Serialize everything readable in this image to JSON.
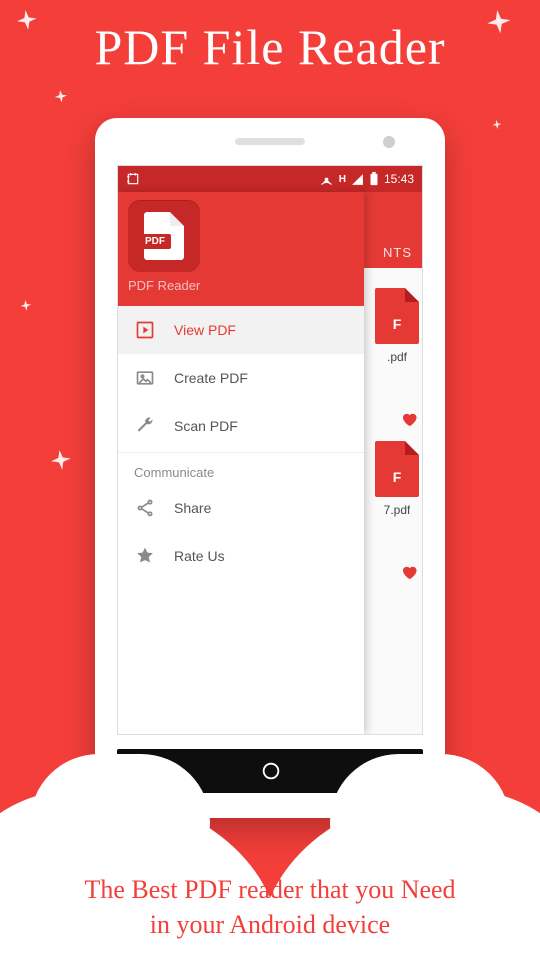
{
  "poster": {
    "title": "PDF File Reader",
    "subtitle_line1": "The Best PDF reader that you Need",
    "subtitle_line2": "in your Android device"
  },
  "statusbar": {
    "time": "15:43",
    "signal_label": "H"
  },
  "behind": {
    "tab_label": "NTS",
    "files": [
      {
        "badge": "F",
        "label": ".pdf"
      },
      {
        "badge": "F",
        "label": "7.pdf"
      }
    ]
  },
  "drawer": {
    "app_badge": "PDF",
    "app_title": "PDF Reader",
    "items": [
      {
        "key": "view",
        "label": "View PDF",
        "active": true
      },
      {
        "key": "create",
        "label": "Create PDF",
        "active": false
      },
      {
        "key": "scan",
        "label": "Scan PDF",
        "active": false
      }
    ],
    "section": "Communicate",
    "comm_items": [
      {
        "key": "share",
        "label": "Share"
      },
      {
        "key": "rate",
        "label": "Rate Us"
      }
    ]
  }
}
